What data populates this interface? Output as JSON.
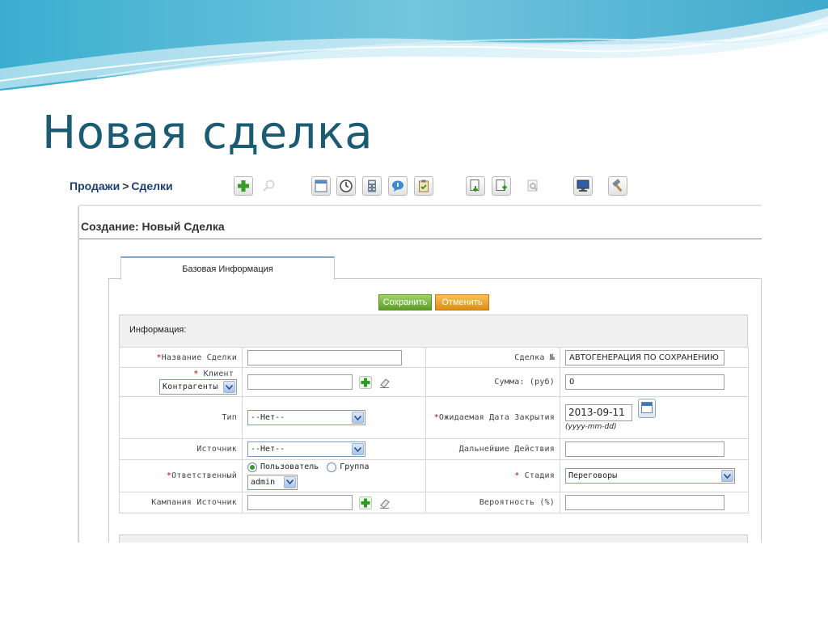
{
  "slide": {
    "title": "Новая сделка",
    "accent_color": "#1b5c74"
  },
  "app": {
    "breadcrumb": {
      "module": "Продажи",
      "separator": ">",
      "section": "Сделки"
    },
    "toolbar": [
      {
        "icon": "add-green-plus-icon"
      },
      {
        "icon": "search-disabled-icon"
      },
      {
        "icon": "calendar-icon"
      },
      {
        "icon": "clock-icon"
      },
      {
        "icon": "calculator-icon"
      },
      {
        "icon": "chat-bubble-icon"
      },
      {
        "icon": "clipboard-icon"
      },
      {
        "icon": "import-icon"
      },
      {
        "icon": "export-icon"
      },
      {
        "icon": "find-duplicates-icon"
      },
      {
        "icon": "monitor-icon"
      },
      {
        "icon": "settings-hammer-icon"
      }
    ],
    "page_heading": "Создание: Новый Сделка",
    "tab_label": "Базовая Информация",
    "buttons": {
      "save": "Сохранить",
      "cancel": "Отменить"
    },
    "colors": {
      "save": "#6aab2f",
      "cancel": "#e8961c",
      "breadcrumb": "#1e3d78"
    },
    "section_header": "Информация:",
    "form": {
      "deal_name": {
        "required_mark": "*",
        "label": "Название Сделки",
        "value": ""
      },
      "deal_number": {
        "label": "Сделка №",
        "value": "АВТОГЕНЕРАЦИЯ ПО СОХРАНЕНИЮ"
      },
      "client": {
        "required_mark": "*",
        "label": "Клиент",
        "type_select": "Контрагенты",
        "value": ""
      },
      "amount": {
        "label": "Сумма: (руб)",
        "value": "0"
      },
      "type": {
        "label": "Тип",
        "value": "--Нет--"
      },
      "close_date": {
        "required_mark": "*",
        "label": "Ожидаемая Дата Закрытия",
        "value": "2013-09-11",
        "hint": "(yyyy-mm-dd)"
      },
      "source": {
        "label": "Источник",
        "value": "--Нет--"
      },
      "next_step": {
        "label": "Дальнейшие Действия",
        "value": ""
      },
      "assigned": {
        "required_mark": "*",
        "label": "Ответственный",
        "option_user": "Пользователь",
        "option_group": "Группа",
        "selected": "user",
        "user_value": "admin"
      },
      "stage": {
        "required_mark": "*",
        "label": "Стадия",
        "value": "Переговоры"
      },
      "campaign_source": {
        "label": "Кампания Источник",
        "value": ""
      },
      "probability": {
        "label": "Вероятность (%)",
        "value": ""
      }
    }
  }
}
